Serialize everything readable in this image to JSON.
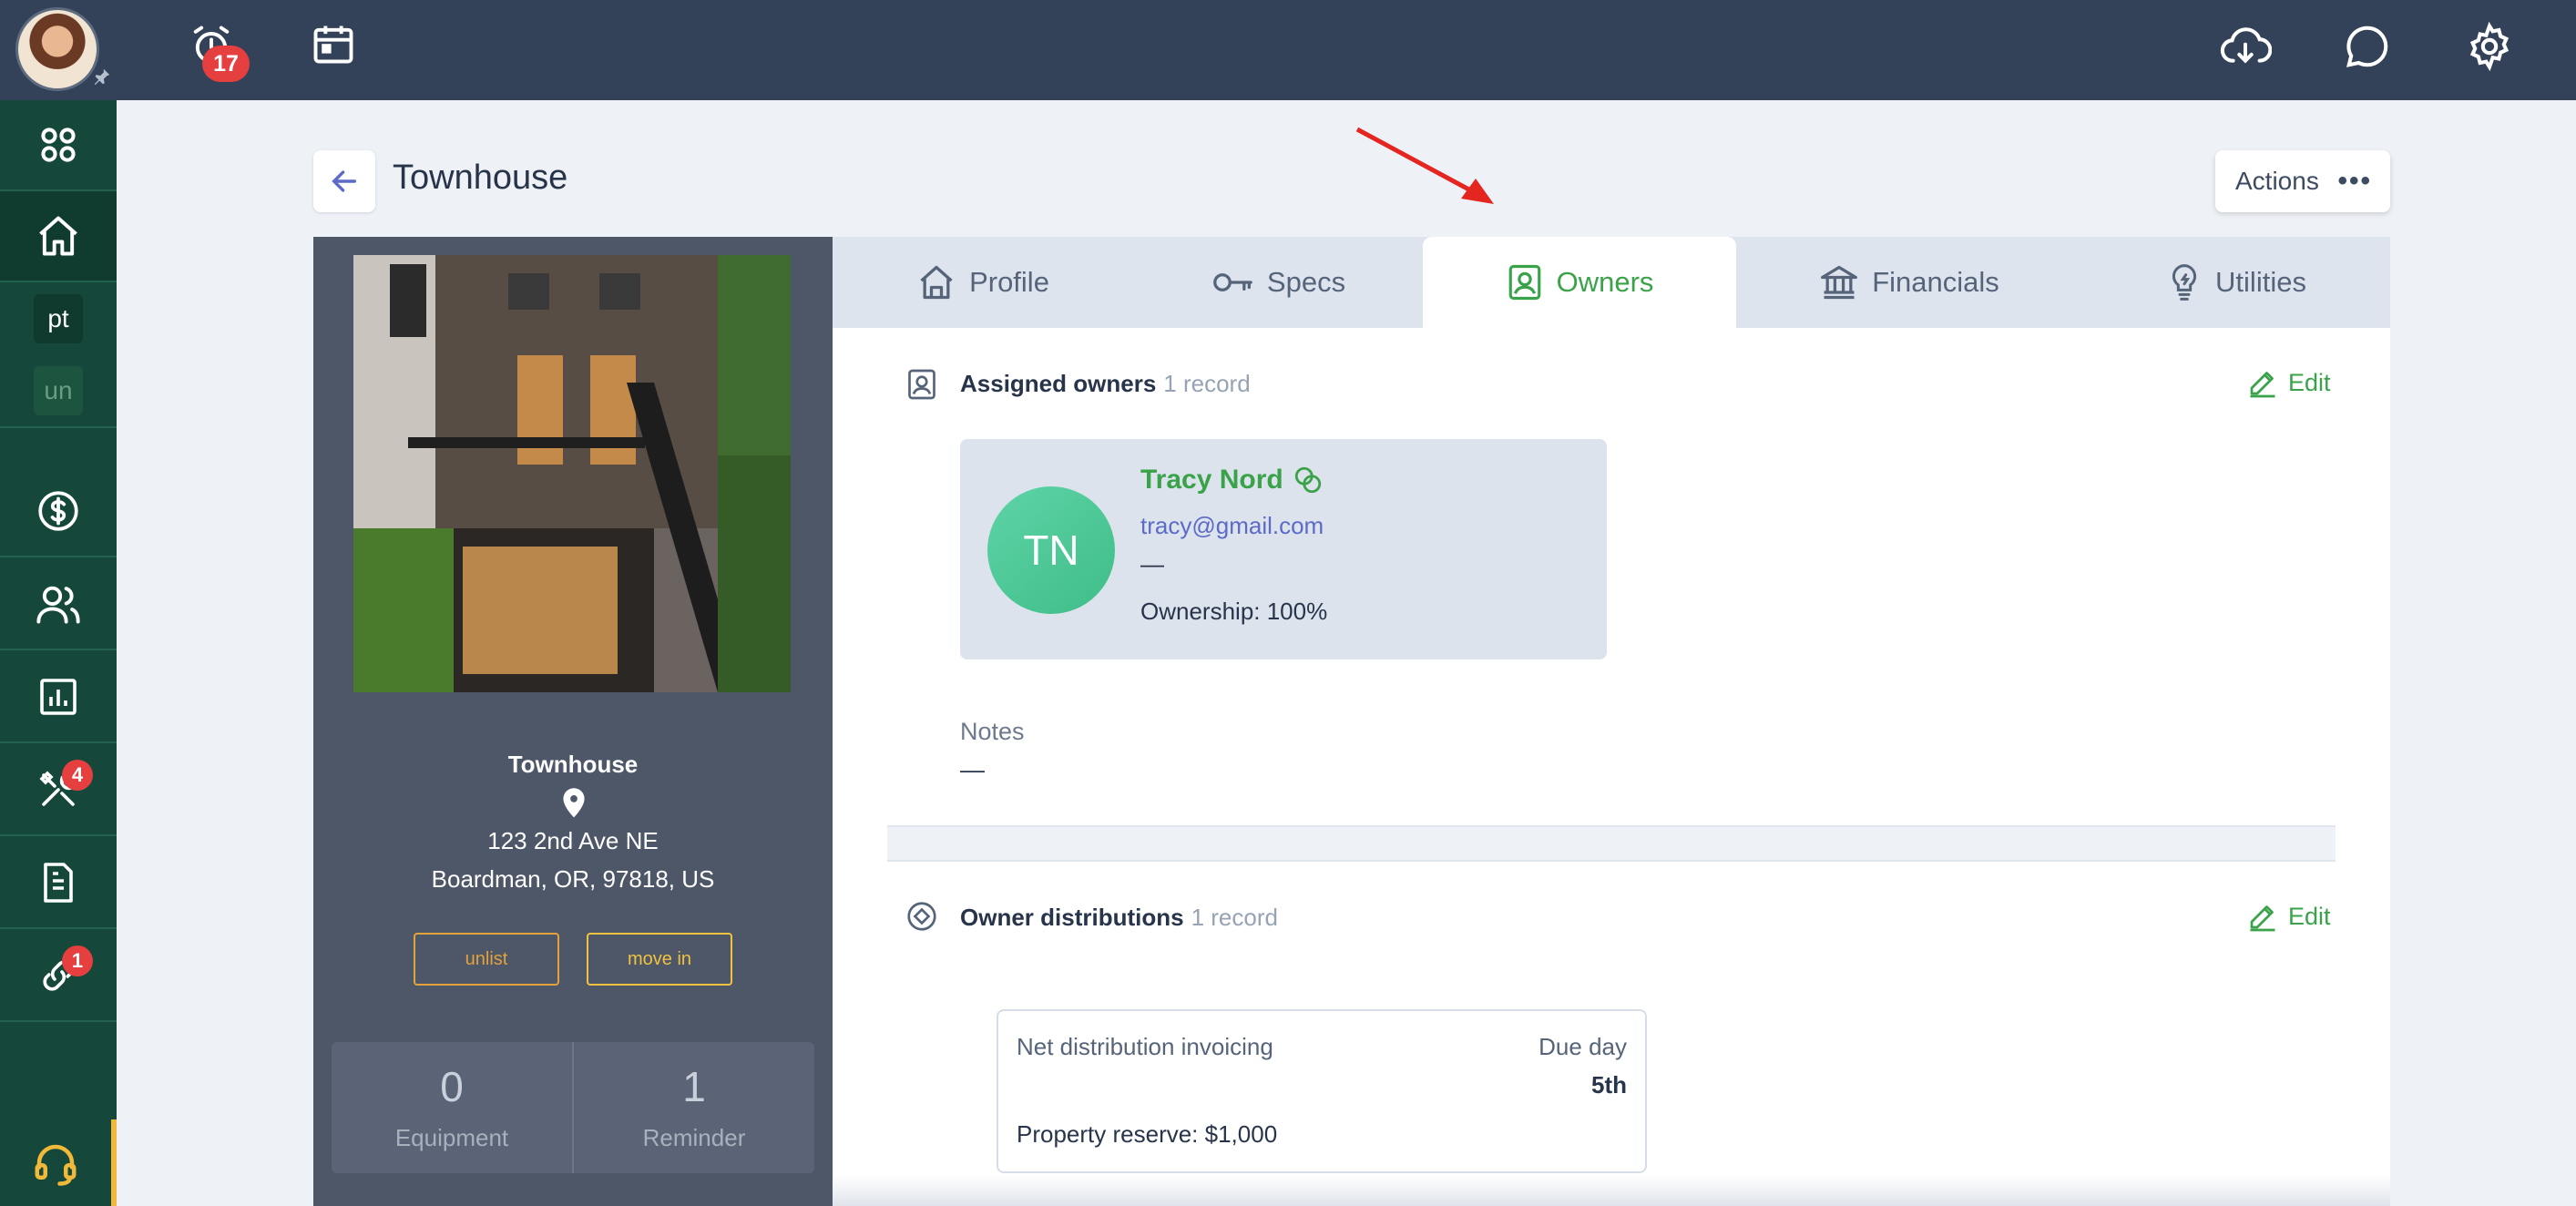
{
  "topbar": {
    "reminders_badge": "17"
  },
  "sidebar": {
    "items": [
      {
        "name": "apps"
      },
      {
        "name": "home"
      },
      {
        "chip": "pt"
      },
      {
        "chip": "un"
      },
      {
        "name": "finance"
      },
      {
        "name": "people"
      },
      {
        "name": "reports"
      },
      {
        "name": "maintenance",
        "badge": "4"
      },
      {
        "name": "documents"
      },
      {
        "name": "links",
        "badge": "1"
      }
    ]
  },
  "header": {
    "title": "Townhouse",
    "actions_label": "Actions"
  },
  "property": {
    "name": "Townhouse",
    "address_line1": "123 2nd Ave NE",
    "address_line2": "Boardman, OR, 97818, US",
    "unlist_label": "unlist",
    "move_in_label": "move in",
    "stats": [
      {
        "value": "0",
        "label": "Equipment"
      },
      {
        "value": "1",
        "label": "Reminder"
      }
    ]
  },
  "tabs": [
    {
      "label": "Profile"
    },
    {
      "label": "Specs"
    },
    {
      "label": "Owners",
      "active": true
    },
    {
      "label": "Financials"
    },
    {
      "label": "Utilities"
    }
  ],
  "assigned_owners": {
    "title": "Assigned owners",
    "count": "1 record",
    "edit_label": "Edit",
    "owner": {
      "initials": "TN",
      "name": "Tracy Nord",
      "email": "tracy@gmail.com",
      "phone": "—",
      "ownership": "Ownership: 100%"
    },
    "notes_label": "Notes",
    "notes_value": "—"
  },
  "owner_distributions": {
    "title": "Owner distributions",
    "count": "1 record",
    "edit_label": "Edit",
    "card": {
      "left_label": "Net distribution invoicing",
      "right_label": "Due day",
      "due_day": "5th",
      "reserve": "Property reserve: $1,000"
    }
  },
  "colors": {
    "topbar": "#344259",
    "sidebar": "#15483a",
    "accent_green": "#3aa34a",
    "link_blue": "#5c6bc8",
    "badge_red": "#e53f3f",
    "unlist_orange": "#e3a23a",
    "move_in_yellow": "#f0c240"
  }
}
